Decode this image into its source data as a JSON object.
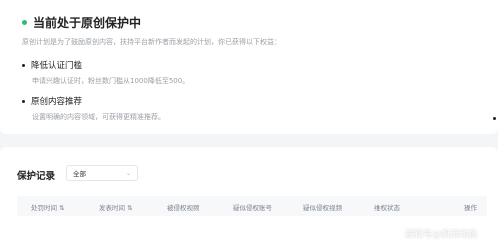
{
  "status": {
    "title": "当前处于原创保护中",
    "description": "原创计划是为了鼓励原创内容，扶持平台新作者而发起的计划，你已获得以下权益：",
    "status_color": "#2dbf6f"
  },
  "benefits": [
    {
      "title": "降低认证门槛",
      "description": "申请兴趣认证时，粉丝数门槛从1000降低至500。"
    },
    {
      "title": "原创内容推荐",
      "description": "设置明确的内容领域，可获得更精准推荐。"
    }
  ],
  "records": {
    "title": "保护记录",
    "filter": {
      "selected": "全部"
    },
    "columns": [
      "处罚时间",
      "发表时间",
      "被侵权视频",
      "疑似侵权账号",
      "疑似侵权视频",
      "维权状态",
      "操作"
    ]
  },
  "watermark": "搜狐号@帆雨动画"
}
